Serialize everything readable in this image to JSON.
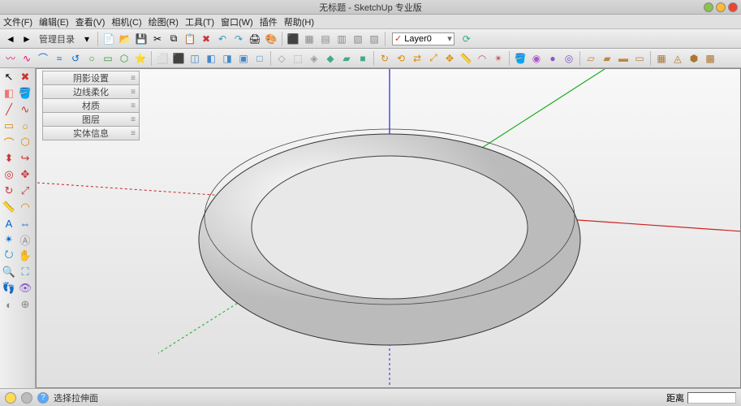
{
  "title": "无标题 - SketchUp 专业版",
  "window_buttons": {
    "min_color": "#8ac24a",
    "max_color": "#ffbb33",
    "close_color": "#ee4433"
  },
  "menu": [
    "文件(F)",
    "编辑(E)",
    "查看(V)",
    "相机(C)",
    "绘图(R)",
    "工具(T)",
    "窗口(W)",
    "插件",
    "帮助(H)"
  ],
  "toolbar1": {
    "nav_back": "◄",
    "nav_fwd": "►",
    "manage_label": "管理目录",
    "icons": [
      "new-icon",
      "open-icon",
      "save-icon",
      "cut-icon",
      "copy-icon",
      "paste-icon",
      "delete-icon",
      "undo-icon",
      "redo-icon",
      "print-icon",
      "palette-icon"
    ],
    "iso_icons": [
      "iso-icon",
      "top-icon",
      "front-icon",
      "side-icon",
      "back-icon",
      "layers-icon"
    ],
    "layer_check": "✓",
    "layer_name": "Layer0",
    "refresh": "⟳"
  },
  "toolbar2_groups": [
    [
      "arc-icon",
      "freehand-icon",
      "curve-icon",
      "bezier-icon",
      "reverse-icon",
      "circle-icon",
      "rect-icon",
      "polygon-icon",
      "star-icon"
    ],
    [
      "view-iso-icon",
      "view-top-icon",
      "view-front-icon",
      "view-right-icon",
      "view-back-icon",
      "view-left-icon",
      "view-bottom-icon"
    ],
    [
      "xray-icon",
      "wireframe-icon",
      "hidden-icon",
      "shaded-icon",
      "shaded-tex-icon",
      "mono-icon"
    ],
    [
      "rotate-icon",
      "rotate90-icon",
      "mirror-icon",
      "scale-icon",
      "move-icon",
      "tape-icon",
      "protractor-icon",
      "axes-icon"
    ],
    [
      "paint-icon",
      "mat1-icon",
      "mat2-icon",
      "mat3-icon"
    ],
    [
      "section-icon",
      "section-display-icon",
      "section-cut-icon",
      "section-fill-icon"
    ],
    [
      "sandbox-icon",
      "smoove-icon",
      "stamp-icon",
      "drape-icon"
    ]
  ],
  "left_tools": [
    [
      "select-icon",
      "✖"
    ],
    [
      "eraser-icon",
      "◧"
    ],
    [
      "line-icon",
      "⟋"
    ],
    [
      "rect-tool-icon",
      "▭"
    ],
    [
      "circle-tool-icon",
      "○"
    ],
    [
      "arc-tool-icon",
      "◡"
    ],
    [
      "push-icon",
      "⬍"
    ],
    [
      "offset-icon",
      "◎"
    ],
    [
      "move-tool-icon",
      "✥"
    ],
    [
      "rotate-tool-icon",
      "↻"
    ],
    [
      "scale-tool-icon",
      "⤢"
    ],
    [
      "tape-tool-icon",
      "—"
    ],
    [
      "orbit-icon",
      "⭮"
    ],
    [
      "pan-icon",
      "✋"
    ],
    [
      "zoom-icon",
      "🔍"
    ],
    [
      "zoom-ext-icon",
      "⛶"
    ],
    [
      "walk-icon",
      "👣"
    ],
    [
      "look-icon",
      "👁"
    ],
    [
      "section-tool-icon",
      "◐"
    ],
    [
      "dims-icon",
      "⇔"
    ]
  ],
  "panels": [
    "阴影设置",
    "边线柔化",
    "材质",
    "图层",
    "实体信息"
  ],
  "status": {
    "hint": "选择拉伸面",
    "measure_label": "距离"
  }
}
